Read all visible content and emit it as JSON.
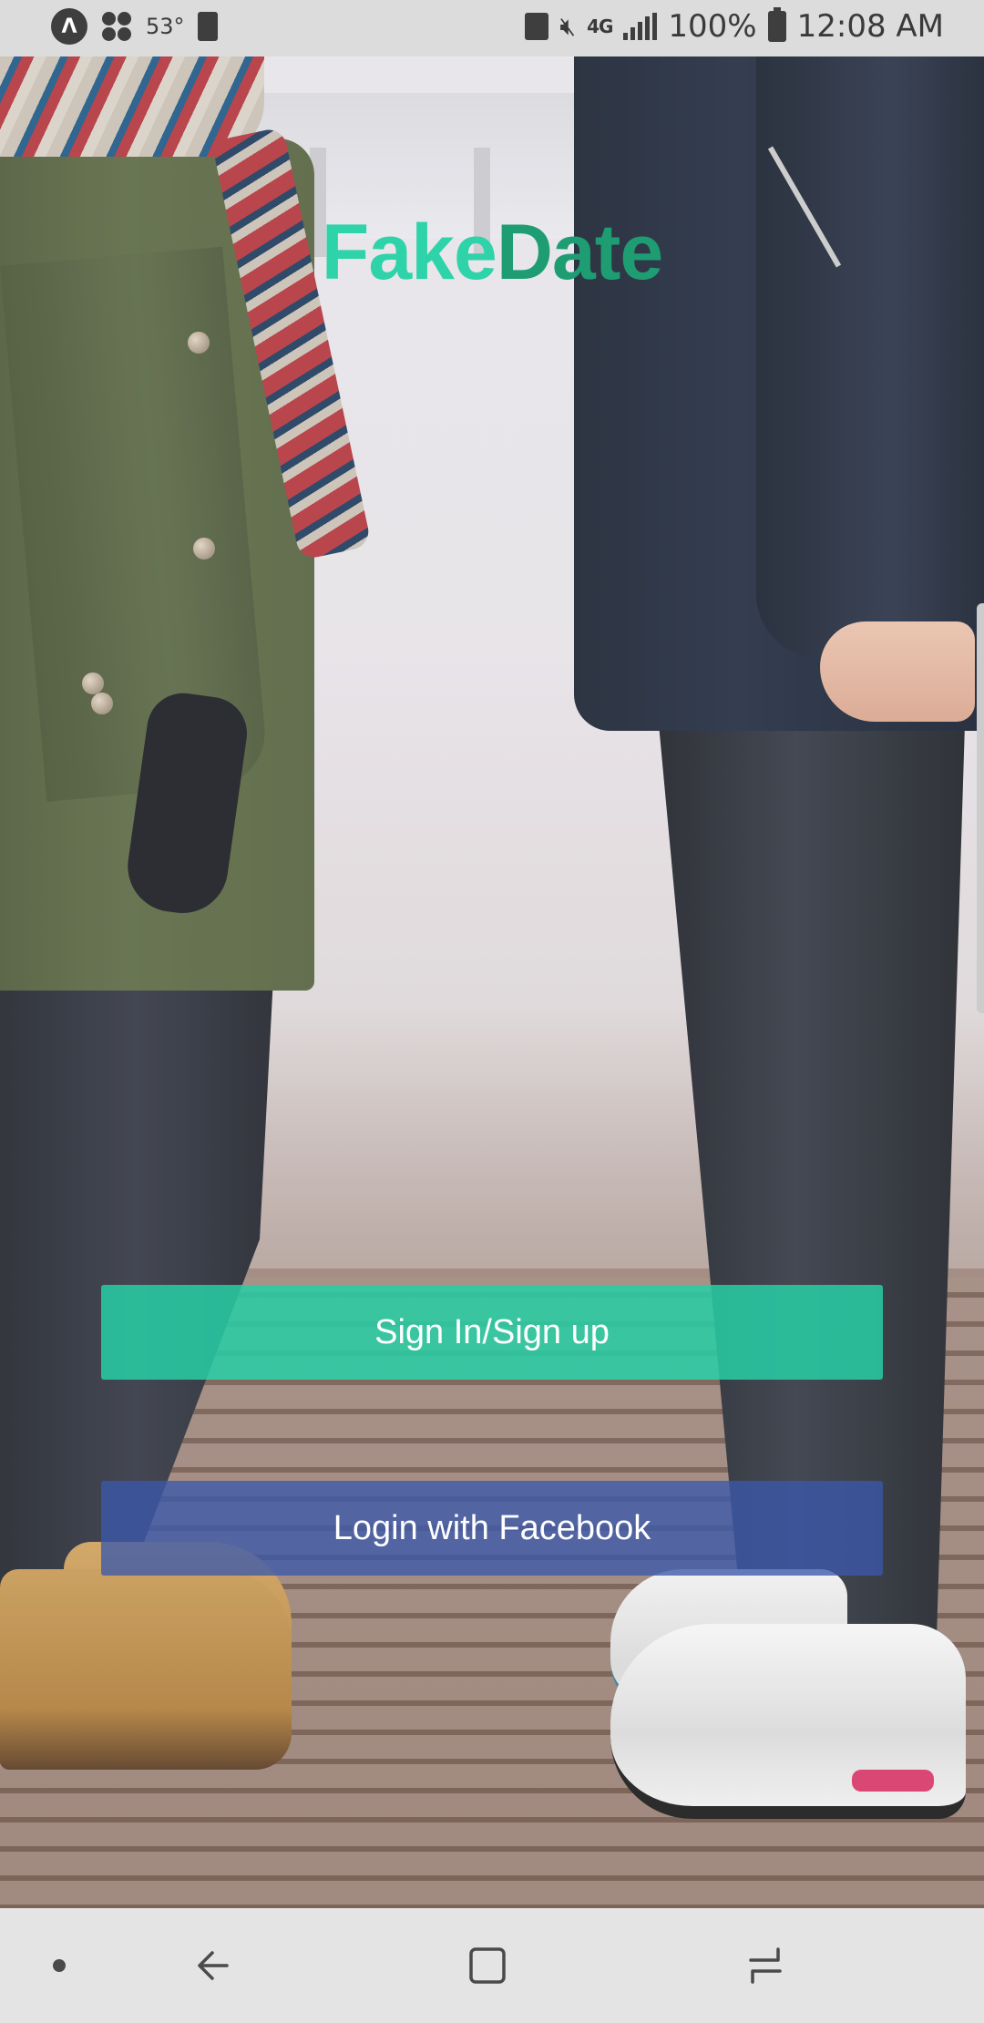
{
  "status_bar": {
    "temperature": "53°",
    "network": "4G",
    "battery_percent": "100%",
    "time": "12:08 AM",
    "left_icons": [
      "app-alert-icon",
      "clover-icon",
      "weather-icon",
      "battery-saver-icon"
    ],
    "right_icons": [
      "recycle-battery-icon",
      "mute-icon",
      "lte-icon",
      "signal-icon",
      "battery-icon"
    ]
  },
  "app": {
    "logo_part1": "Fake",
    "logo_part2": "Date",
    "logo_colors": {
      "fake": "#2fd3a9",
      "date": "#1e9d73"
    }
  },
  "buttons": {
    "signin_label": "Sign In/Sign up",
    "facebook_label": "Login with Facebook",
    "signin_color": "#28cea5",
    "facebook_color": "#3b59aa"
  },
  "nav_bar": {
    "items": [
      "dot-icon",
      "back-icon",
      "home-icon",
      "recent-apps-icon"
    ]
  }
}
